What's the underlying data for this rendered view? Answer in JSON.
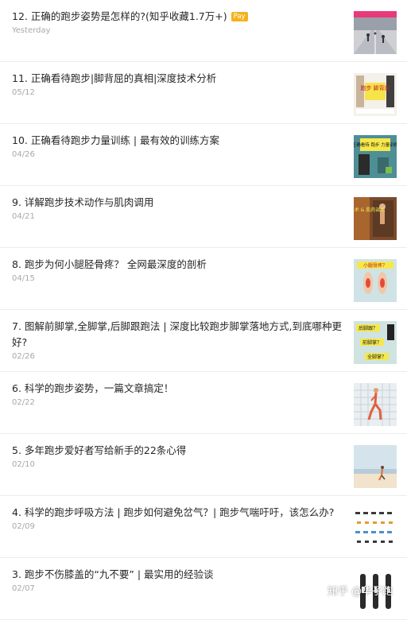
{
  "articles": [
    {
      "title": "12. 正确的跑步姿势是怎样的?(知乎收藏1.7万+)",
      "badge": "Pay",
      "date": "Yesterday"
    },
    {
      "title": "11. 正确看待跑步|脚背屈的真相|深度技术分析",
      "date": "05/12"
    },
    {
      "title": "10. 正确看待跑步力量训练 | 最有效的训练方案",
      "date": "04/26"
    },
    {
      "title": "9. 详解跑步技术动作与肌肉调用",
      "date": "04/21"
    },
    {
      "title": "8. 跑步为何小腿胫骨疼？ 全网最深度的剖析",
      "date": "04/15"
    },
    {
      "title": "7. 图解前脚掌,全脚掌,后脚跟跑法 | 深度比较跑步脚掌落地方式,到底哪种更好?",
      "date": "02/26"
    },
    {
      "title": "6. 科学的跑步姿势，一篇文章搞定！",
      "date": "02/22"
    },
    {
      "title": "5. 多年跑步爱好者写给新手的22条心得",
      "date": "02/10"
    },
    {
      "title": "4. 科学的跑步呼吸方法 | 跑步如何避免岔气？| 跑步气喘吁吁，该怎么办?",
      "date": "02/09"
    },
    {
      "title": "3. 跑步不伤膝盖的“九不要” | 最实用的经验谈",
      "date": "02/07"
    }
  ],
  "thumb_text": {
    "t11": "跑步 脚背屈",
    "t10": "正确看待 跑步 力量训练",
    "t9": "跑步 技术 & 肌肉调用",
    "t8": "小腿骨疼？",
    "t7a": "后脚跟？",
    "t7b": "前脚掌？",
    "t7c": "全脚掌？"
  },
  "watermark": "知乎 @华子跑",
  "colors": {
    "pay_badge": "#f3b21b",
    "date": "#a8a8a8",
    "title": "#262626"
  }
}
